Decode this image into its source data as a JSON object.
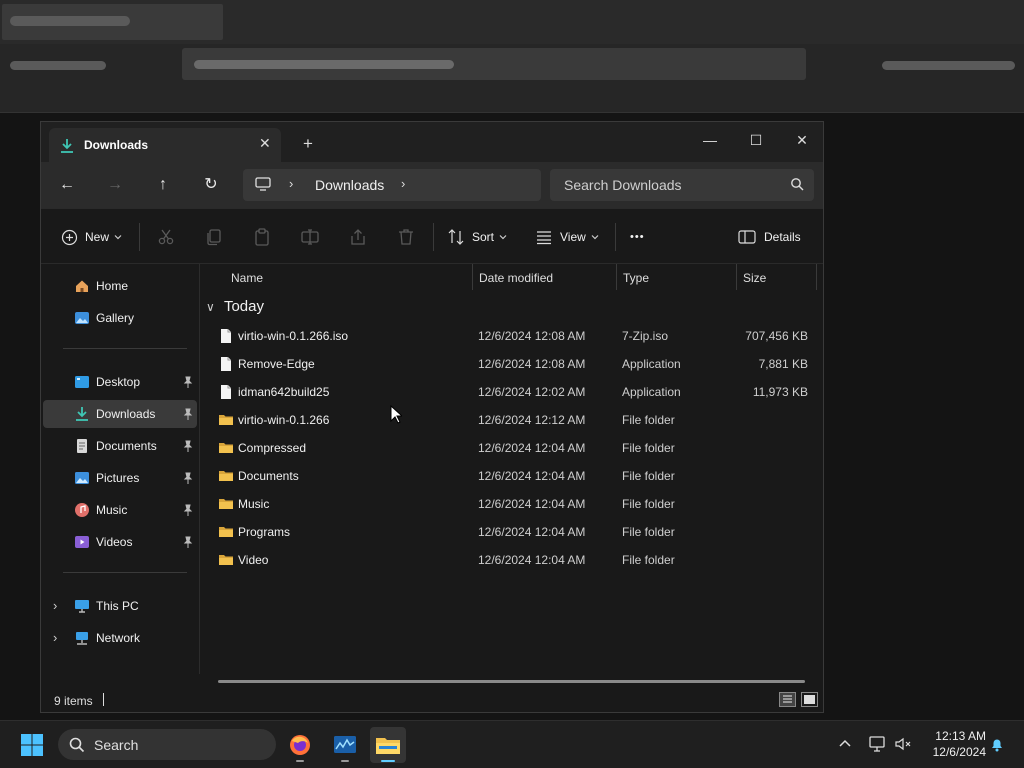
{
  "window": {
    "tab_title": "Downloads",
    "new_tab": "+",
    "controls": {
      "minimize": "—",
      "maximize": "☐",
      "close": "✕"
    }
  },
  "navbar": {
    "back": "←",
    "forward": "→",
    "up": "↑",
    "refresh": "↻",
    "breadcrumb": {
      "separator": "›",
      "current": "Downloads"
    },
    "search_placeholder": "Search Downloads"
  },
  "commandbar": {
    "new_label": "New",
    "sort_label": "Sort",
    "view_label": "View",
    "more_label": "•••",
    "details_label": "Details"
  },
  "sidebar": {
    "quick": [
      {
        "label": "Home",
        "icon": "home-icon"
      },
      {
        "label": "Gallery",
        "icon": "gallery-icon"
      }
    ],
    "pinned": [
      {
        "label": "Desktop",
        "icon": "desktop-icon"
      },
      {
        "label": "Downloads",
        "icon": "downloads-icon",
        "active": true
      },
      {
        "label": "Documents",
        "icon": "documents-icon"
      },
      {
        "label": "Pictures",
        "icon": "pictures-icon"
      },
      {
        "label": "Music",
        "icon": "music-icon"
      },
      {
        "label": "Videos",
        "icon": "videos-icon"
      }
    ],
    "tree": [
      {
        "label": "This PC",
        "icon": "this-pc-icon"
      },
      {
        "label": "Network",
        "icon": "network-icon"
      }
    ],
    "expand_glyph": "›"
  },
  "file_list": {
    "columns": {
      "name": "Name",
      "date": "Date modified",
      "type": "Type",
      "size": "Size"
    },
    "group_label": "Today",
    "group_chevron": "∨",
    "rows": [
      {
        "name": "virtio-win-0.1.266.iso",
        "date": "12/6/2024 12:08 AM",
        "type": "7-Zip.iso",
        "size": "707,456 KB",
        "kind": "file"
      },
      {
        "name": "Remove-Edge",
        "date": "12/6/2024 12:08 AM",
        "type": "Application",
        "size": "7,881 KB",
        "kind": "file"
      },
      {
        "name": "idman642build25",
        "date": "12/6/2024 12:02 AM",
        "type": "Application",
        "size": "11,973 KB",
        "kind": "file"
      },
      {
        "name": "virtio-win-0.1.266",
        "date": "12/6/2024 12:12 AM",
        "type": "File folder",
        "size": "",
        "kind": "folder"
      },
      {
        "name": "Compressed",
        "date": "12/6/2024 12:04 AM",
        "type": "File folder",
        "size": "",
        "kind": "folder"
      },
      {
        "name": "Documents",
        "date": "12/6/2024 12:04 AM",
        "type": "File folder",
        "size": "",
        "kind": "folder"
      },
      {
        "name": "Music",
        "date": "12/6/2024 12:04 AM",
        "type": "File folder",
        "size": "",
        "kind": "folder"
      },
      {
        "name": "Programs",
        "date": "12/6/2024 12:04 AM",
        "type": "File folder",
        "size": "",
        "kind": "folder"
      },
      {
        "name": "Video",
        "date": "12/6/2024 12:04 AM",
        "type": "File folder",
        "size": "",
        "kind": "folder"
      }
    ]
  },
  "status": {
    "item_count": "9 items"
  },
  "taskbar": {
    "search_label": "Search",
    "time": "12:13 AM",
    "date": "12/6/2024"
  },
  "colors": {
    "accent": "#60cdff",
    "folder": "#f2c14e",
    "window_bg": "#191919"
  }
}
